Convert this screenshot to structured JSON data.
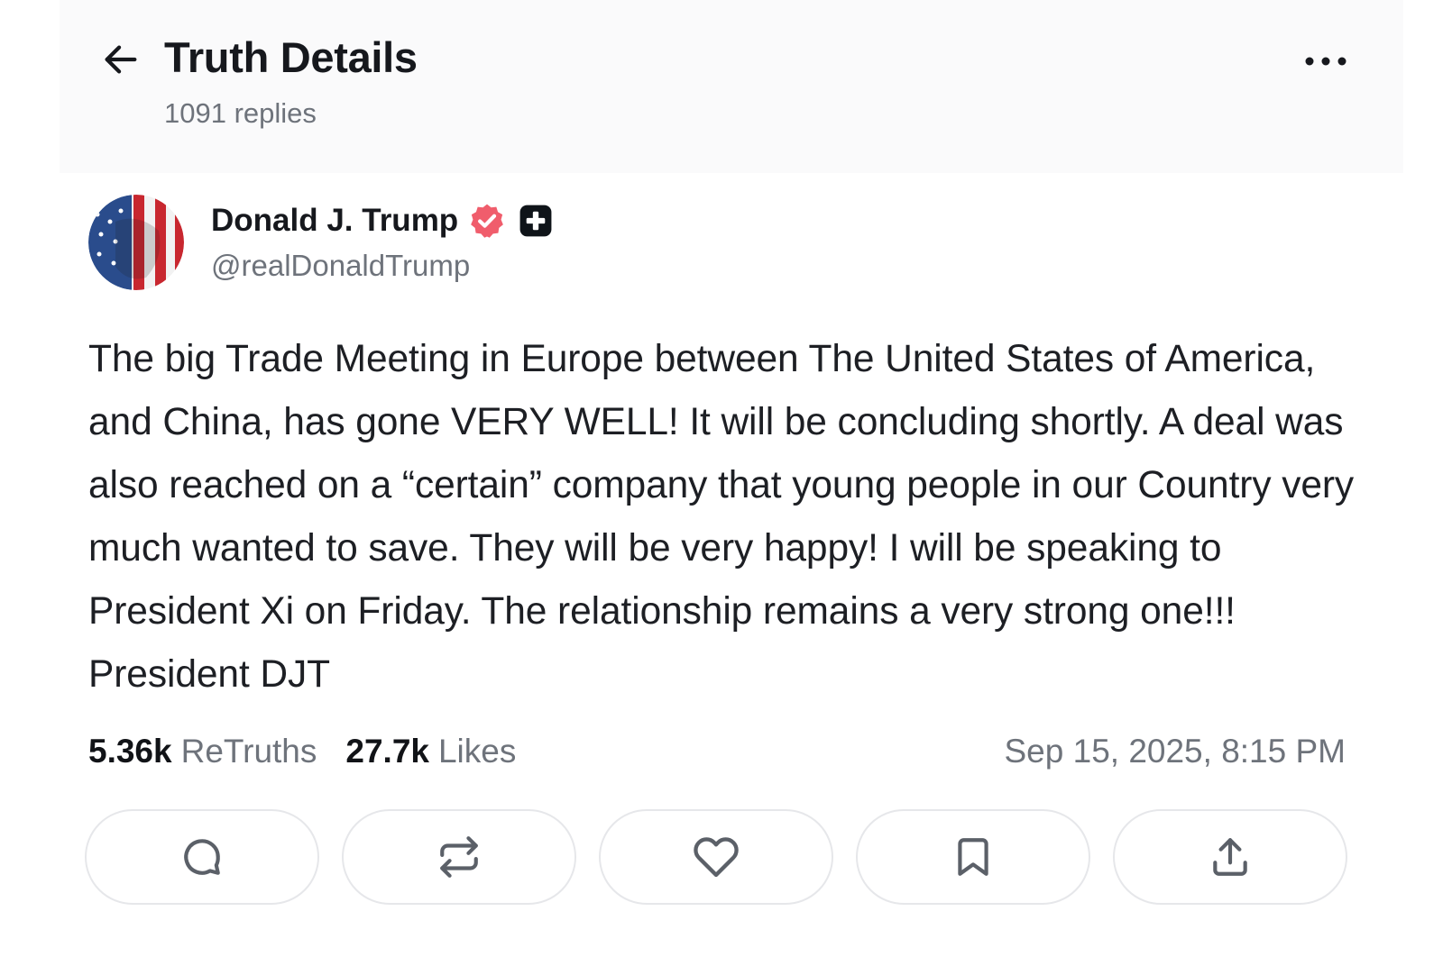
{
  "header": {
    "title": "Truth Details",
    "reply_count": "1091 replies",
    "back_icon": "arrow-left-icon",
    "more_icon": "more-horizontal-icon"
  },
  "post": {
    "author": {
      "display_name": "Donald J. Trump",
      "handle": "@realDonaldTrump",
      "verified_badge_color": "#f05d6c",
      "plus_badge_color": "#0f1419"
    },
    "text": "The big Trade Meeting in Europe between The United States of America, and China,  has gone VERY WELL! It will be concluding shortly. A deal was also reached on a “certain” company that young people in our Country very much wanted to save. They will be very happy! I will be speaking to President Xi on Friday. The relationship remains a very strong one!!! President DJT",
    "stats": {
      "retruths_count": "5.36k",
      "retruths_label": "ReTruths",
      "likes_count": "27.7k",
      "likes_label": "Likes"
    },
    "timestamp": "Sep 15, 2025, 8:15 PM"
  },
  "actions": [
    {
      "name": "reply",
      "icon": "comment-icon"
    },
    {
      "name": "retruth",
      "icon": "repeat-icon"
    },
    {
      "name": "like",
      "icon": "heart-icon"
    },
    {
      "name": "bookmark",
      "icon": "bookmark-icon"
    },
    {
      "name": "share",
      "icon": "share-icon"
    }
  ],
  "colors": {
    "text_primary": "#16181d",
    "text_secondary": "#6e737b",
    "border": "#e6e7ea",
    "header_bg": "#fafafb"
  }
}
